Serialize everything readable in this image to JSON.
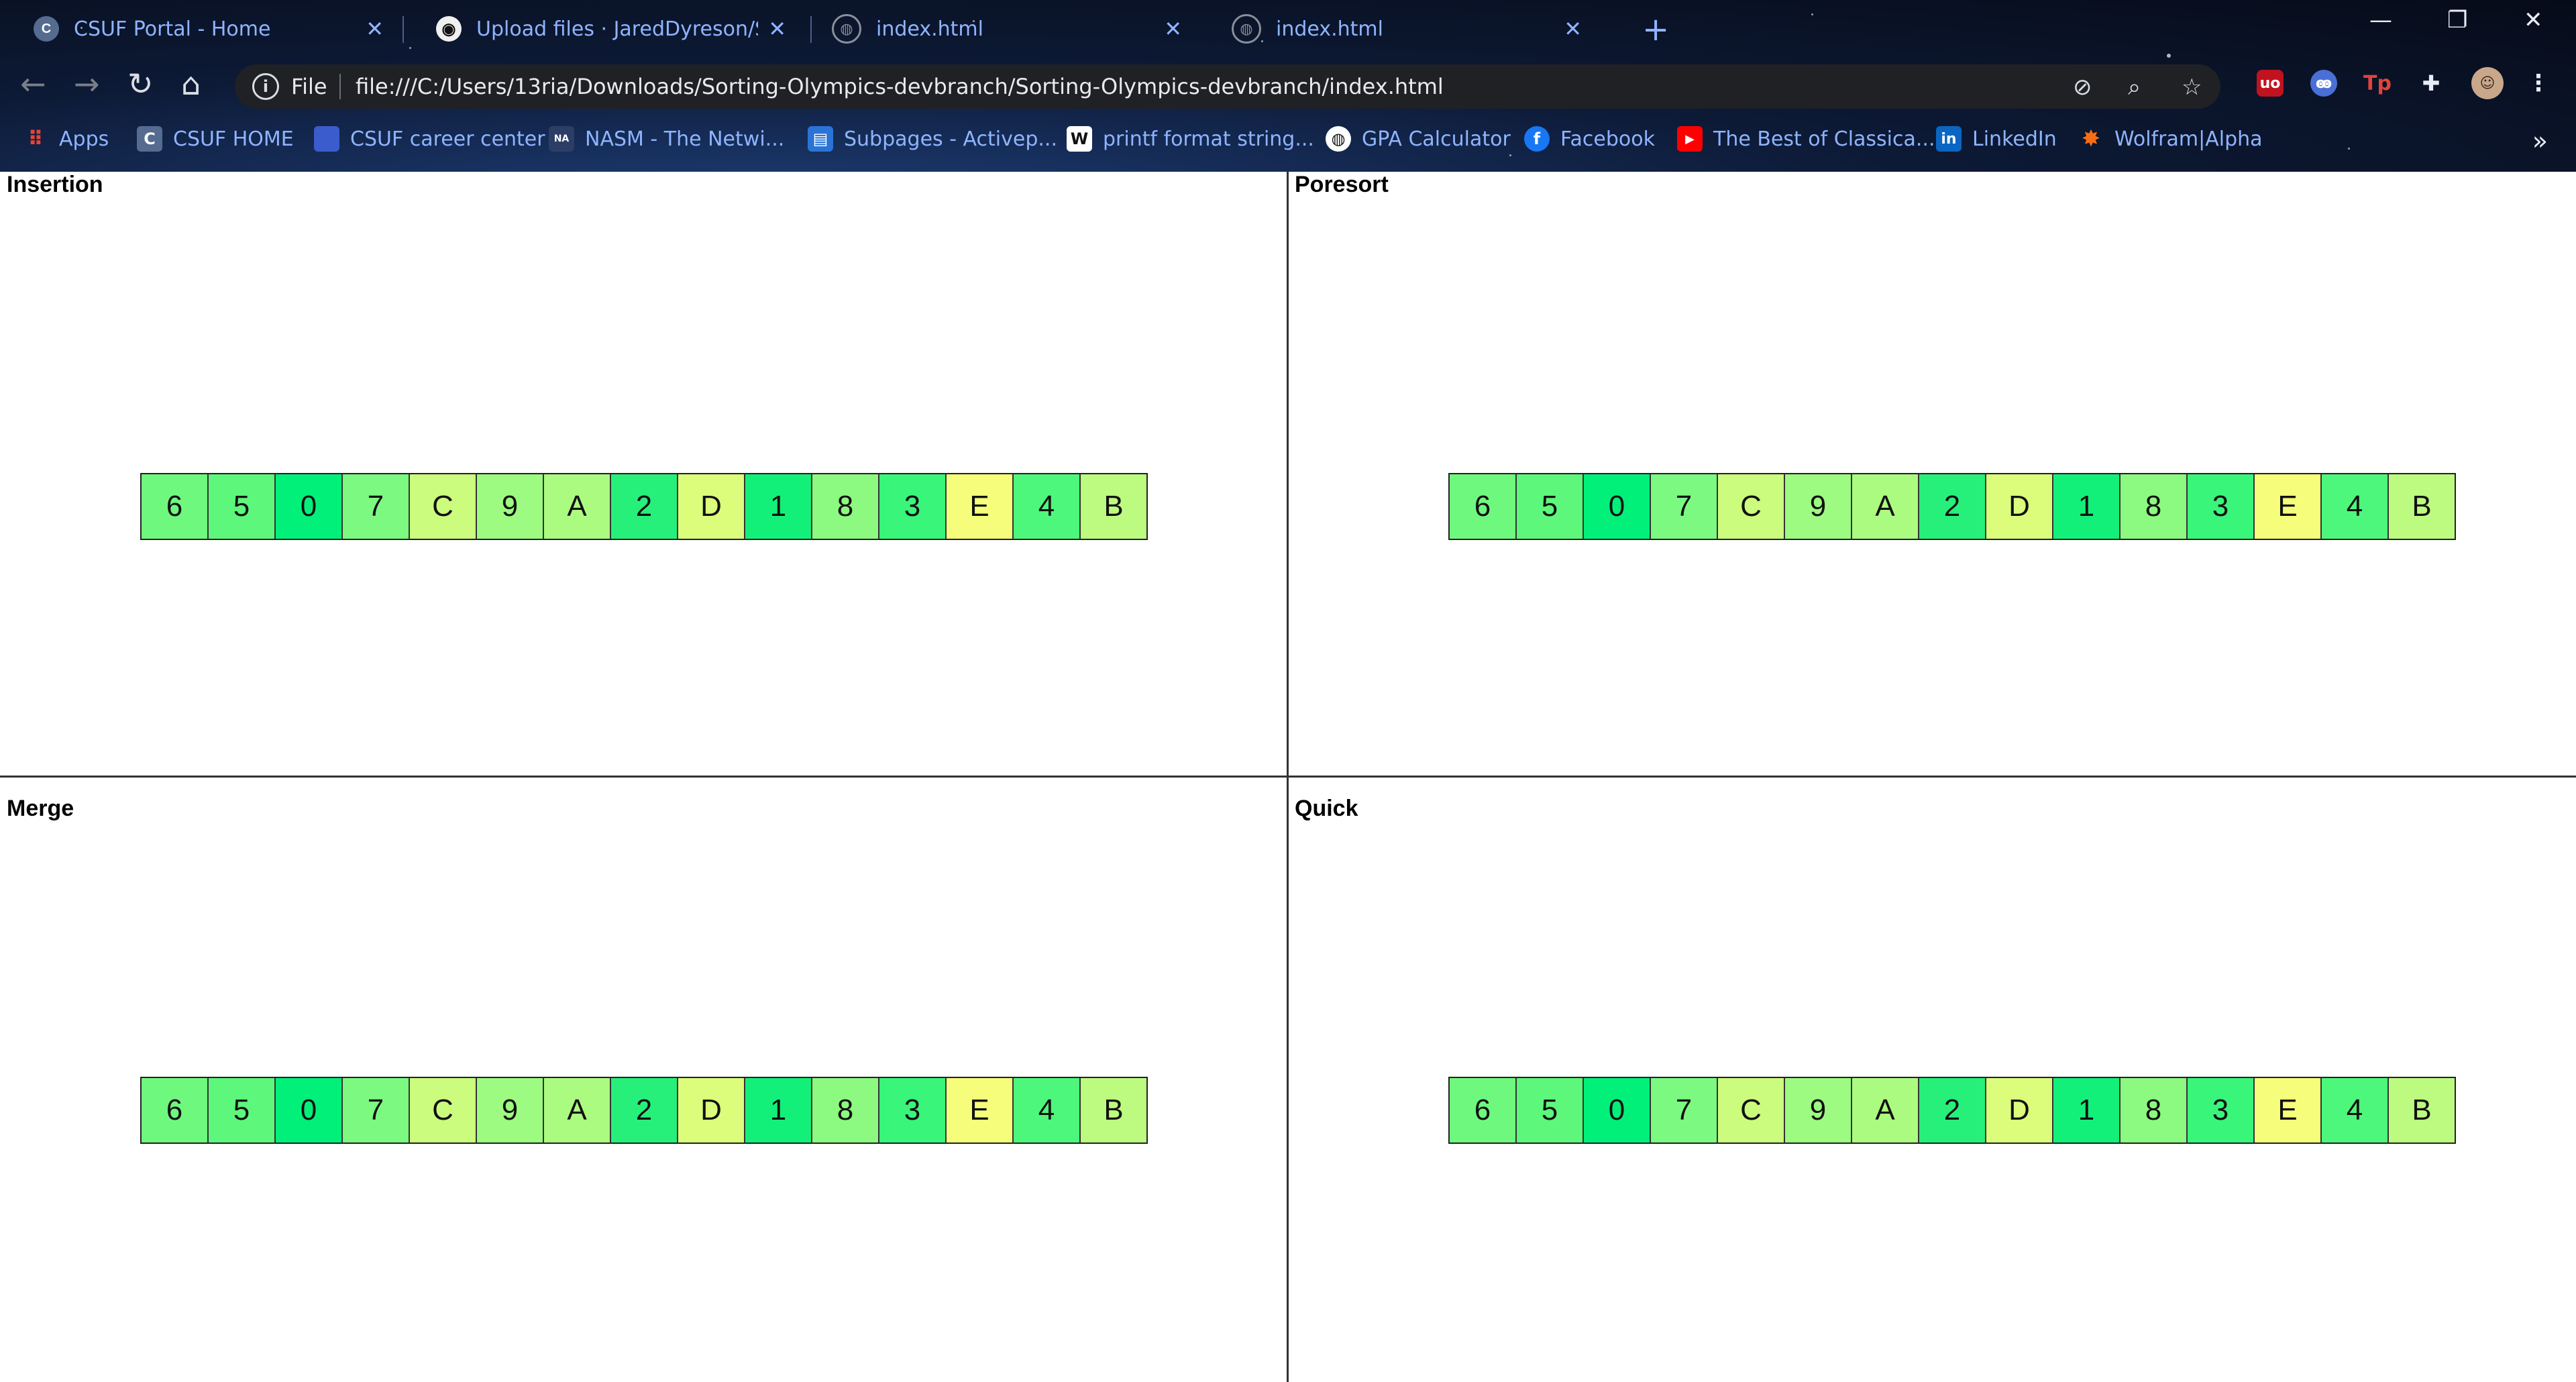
{
  "browser": {
    "tabs": [
      {
        "title": "CSUF Portal - Home",
        "icon": "csuf-favicon"
      },
      {
        "title": "Upload files · JaredDyreson/Sorting",
        "icon": "github-icon"
      },
      {
        "title": "index.html",
        "icon": "globe-icon"
      },
      {
        "title": "index.html",
        "icon": "globe-icon"
      }
    ],
    "new_tab_label": "+",
    "omnibox": {
      "scheme": "File",
      "url": "file:///C:/Users/13ria/Downloads/Sorting-Olympics-devbranch/Sorting-Olympics-devbranch/index.html"
    },
    "bookmarks": [
      {
        "label": "Apps",
        "icon": "apps-grid-icon",
        "color": "#ea4335"
      },
      {
        "label": "CSUF HOME",
        "icon": "csuf-icon",
        "color": "#556b8f"
      },
      {
        "label": "CSUF career center",
        "icon": "bookmark-page-icon",
        "color": "#3a5ccc"
      },
      {
        "label": "NASM - The Netwi...",
        "icon": "nasm-icon",
        "color": "#2c3e66"
      },
      {
        "label": "Subpages - Activep...",
        "icon": "activepieces-icon",
        "color": "#2a74d6"
      },
      {
        "label": "printf format string...",
        "icon": "wikipedia-icon",
        "color": "#ffffff"
      },
      {
        "label": "GPA Calculator",
        "icon": "globe-icon",
        "color": "#ffffff"
      },
      {
        "label": "Facebook",
        "icon": "facebook-icon",
        "color": "#1877f2"
      },
      {
        "label": "The Best of Classica...",
        "icon": "youtube-icon",
        "color": "#ff0000"
      },
      {
        "label": "LinkedIn",
        "icon": "linkedin-icon",
        "color": "#0a66c2"
      },
      {
        "label": "Wolfram|Alpha",
        "icon": "wolframalpha-icon",
        "color": "#f96d12"
      }
    ],
    "bookmarks_more": "»"
  },
  "panels": [
    {
      "title": "Insertion"
    },
    {
      "title": "Poresort"
    },
    {
      "title": "Merge"
    },
    {
      "title": "Quick"
    }
  ],
  "array_values": [
    "6",
    "5",
    "0",
    "7",
    "C",
    "9",
    "A",
    "2",
    "D",
    "1",
    "8",
    "3",
    "E",
    "4",
    "B"
  ],
  "cell_colors": {
    "0": "#00f07a",
    "1": "#13f079",
    "2": "#26f07a",
    "3": "#39f57a",
    "4": "#4df77b",
    "5": "#5cf77b",
    "6": "#6ef97e",
    "7": "#7cf981",
    "8": "#8cfa80",
    "9": "#9cfb80",
    "A": "#acfb81",
    "B": "#bcfb80",
    "C": "#ccfc7e",
    "D": "#dcfd7c",
    "E": "#f6fd7a"
  }
}
